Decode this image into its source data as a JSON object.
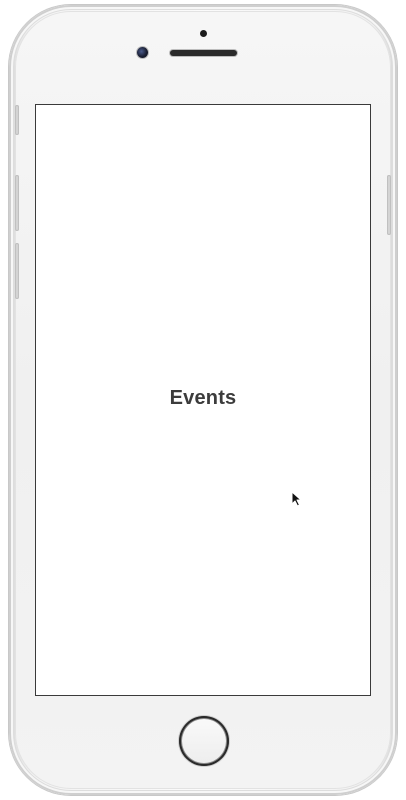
{
  "device": {
    "type": "iPhone",
    "color": "#f4f4f4"
  },
  "screen": {
    "title": "Events",
    "background": "#ffffff",
    "title_color": "#3c3c3c"
  },
  "icons": {
    "camera": "camera-icon",
    "cursor": "mouse-pointer-icon"
  }
}
